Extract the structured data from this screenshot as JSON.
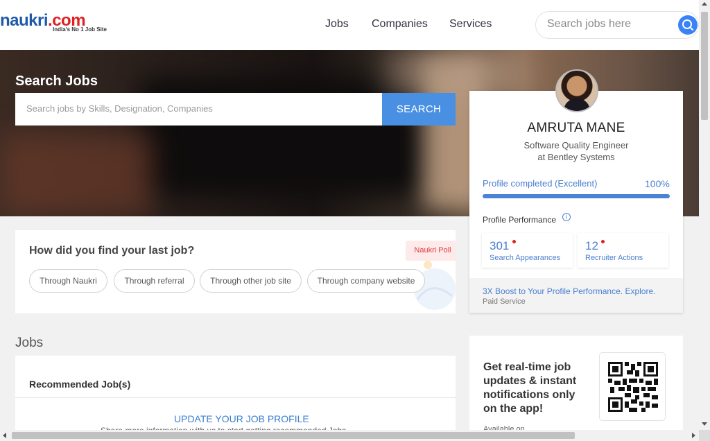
{
  "header": {
    "logo_main": "naukri",
    "logo_dot": ".com",
    "logo_tagline": "India's No 1 Job Site",
    "nav": [
      "Jobs",
      "Companies",
      "Services"
    ],
    "search_placeholder": "Search jobs here"
  },
  "hero": {
    "title": "Search Jobs",
    "search_placeholder": "Search jobs by Skills, Designation, Companies",
    "search_button": "SEARCH"
  },
  "poll": {
    "question": "How did you find your last job?",
    "badge": "Naukri Poll",
    "options": [
      "Through Naukri",
      "Through referral",
      "Through other job site",
      "Through company website"
    ]
  },
  "jobs": {
    "heading": "Jobs",
    "recommended_heading": "Recommended Job(s)",
    "update_link": "UPDATE YOUR JOB PROFILE",
    "share_text": "Share more information with us to start getting recommended Jobs"
  },
  "profile": {
    "name": "AMRUTA MANE",
    "role": "Software Quality Engineer",
    "company": "at Bentley Systems",
    "completion_label": "Profile completed (Excellent)",
    "completion_percent": "100%",
    "completion_value": 100,
    "performance_label": "Profile Performance",
    "info_glyph": "i",
    "stats": [
      {
        "value": "301",
        "label": "Search Appearances"
      },
      {
        "value": "12",
        "label": "Recruiter Actions"
      }
    ],
    "boost_link": "3X Boost to Your Profile Performance. Explore.",
    "boost_sub": "Paid Service"
  },
  "app_promo": {
    "text": "Get real-time job updates & instant notifications only on the app!",
    "available": "Available on"
  },
  "colors": {
    "brand_blue": "#4a90e2",
    "accent_red": "#e02020",
    "link_blue": "#4a7fd0"
  }
}
